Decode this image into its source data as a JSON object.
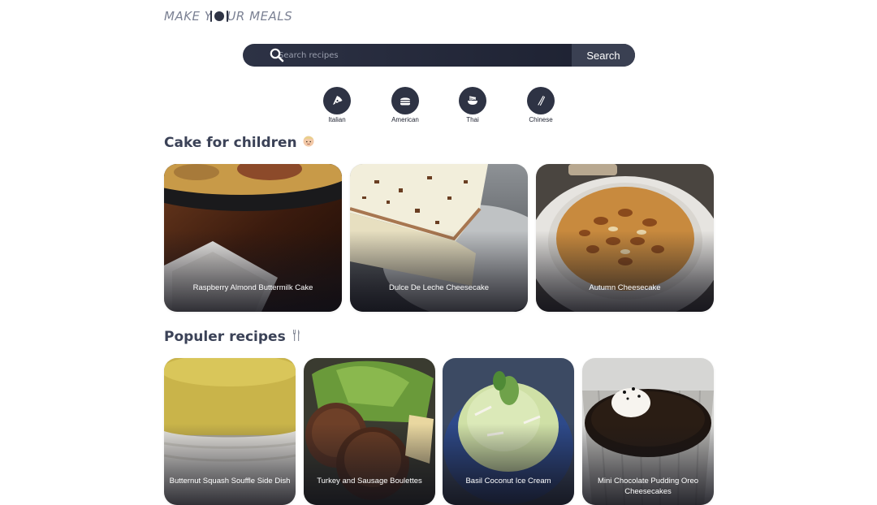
{
  "brand": {
    "logo_left": "MAKE Y",
    "logo_right": "UR MEALS"
  },
  "search": {
    "placeholder": "Search recipes",
    "button_label": "Search"
  },
  "cuisines": [
    {
      "label": "Italian",
      "icon": "pizza-icon"
    },
    {
      "label": "American",
      "icon": "burger-icon"
    },
    {
      "label": "Thai",
      "icon": "noodle-bowl-icon"
    },
    {
      "label": "Chinese",
      "icon": "chopsticks-icon"
    }
  ],
  "sections": {
    "cake": {
      "title": "Cake for children",
      "emoji": "👶",
      "cards": [
        {
          "title": "Raspberry Almond Buttermilk Cake"
        },
        {
          "title": "Dulce De Leche Cheesecake"
        },
        {
          "title": "Autumn Cheesecake"
        }
      ]
    },
    "popular": {
      "title": "Populer recipes",
      "emoji": "🍴",
      "cards": [
        {
          "title": "Butternut Squash Souffle Side Dish"
        },
        {
          "title": "Turkey and Sausage Boulettes"
        },
        {
          "title": "Basil Coconut Ice Cream"
        },
        {
          "title": "Mini Chocolate Pudding Oreo Cheesecakes"
        }
      ]
    }
  },
  "colors": {
    "primary_dark": "#2e3344",
    "heading": "#3b4257",
    "background": "#ffffff"
  }
}
